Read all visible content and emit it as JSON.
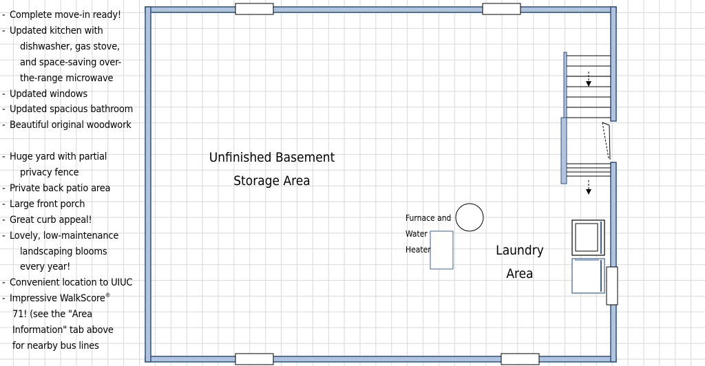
{
  "features": [
    {
      "lines": [
        "Complete move-in ready!"
      ]
    },
    {
      "lines": [
        "Updated kitchen with",
        "dishwasher, gas stove,",
        "and space-saving over-",
        "the-range microwave"
      ]
    },
    {
      "lines": [
        "Updated windows"
      ]
    },
    {
      "lines": [
        "Updated spacious bathroom"
      ]
    },
    {
      "lines": [
        "Beautiful original woodwork"
      ]
    },
    {
      "lines": [
        "Huge yard with partial",
        "privacy fence"
      ],
      "gap_before": true
    },
    {
      "lines": [
        "Private back patio area"
      ]
    },
    {
      "lines": [
        "Large front porch"
      ]
    },
    {
      "lines": [
        "Great curb appeal!"
      ]
    },
    {
      "lines": [
        "Lovely, low-maintenance",
        "landscaping blooms",
        "every year!"
      ]
    },
    {
      "lines": [
        "Convenient location to UIUC"
      ]
    },
    {
      "lines": [
        "Impressive WalkScore",
        "71! (see the \"Area",
        "Information\" tab above",
        "for nearby bus lines"
      ],
      "superscript": "®",
      "hanging_indent": "small"
    }
  ],
  "rooms": {
    "storage_line1": "Unfinished Basement",
    "storage_line2": "Storage Area",
    "laundry_line1": "Laundry",
    "laundry_line2": "Area",
    "furnace_line1": "Furnace and",
    "furnace_line2": "Water",
    "furnace_line3": "Heater"
  },
  "colors": {
    "wall_fill": "#b0c4de",
    "wall_stroke": "#2f4f7f",
    "grid": "#d8d8d8",
    "appliance_stroke": "#3a5f9a"
  },
  "icons": [
    "stairs",
    "door-swing",
    "furnace-circle",
    "water-heater",
    "washer",
    "dryer",
    "window"
  ]
}
